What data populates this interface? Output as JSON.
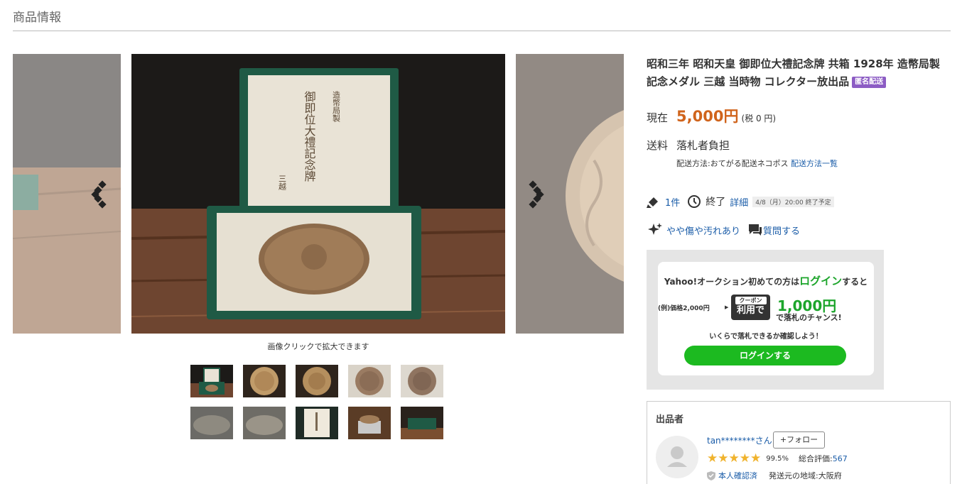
{
  "section": {
    "title": "商品情報"
  },
  "gallery": {
    "caption": "画像クリックで拡大できます",
    "medal_texts": {
      "col1": "造幣局製",
      "col2": "御即位大禮記念牌",
      "col3": "三越"
    }
  },
  "item": {
    "title": "昭和三年 昭和天皇 御即位大禮記念牌 共箱 1928年 造幣局製 記念メダル 三越 当時物 コレクター放出品",
    "badge": "匿名配送",
    "price_label": "現在",
    "price": "5,000円",
    "tax": "(税 0 円)",
    "shipping_label": "送料",
    "shipping_value": "落札者負担",
    "shipping_method": "配送方法:おてがる配送ネコポス",
    "shipping_list_link": "配送方法一覧",
    "bids": "1件",
    "end_label": "終了",
    "end_detail_link": "詳細",
    "end_note": "4/8（月）20:00 終了予定",
    "condition": "やや傷や汚れあり",
    "question": "質問する"
  },
  "coupon": {
    "line1_pre": "Yahoo!オークション初めての方は",
    "line1_login": "ログイン",
    "line1_post": "すると",
    "example": "(例)価格2,000円",
    "tag_top": "クーポン",
    "tag_bottom": "利用で",
    "amount": "1,000円",
    "chance": "で落札のチャンス!",
    "check": "いくらで落札できるか確認しよう！",
    "button": "ログインする"
  },
  "seller": {
    "header": "出品者",
    "name": "tan********さん",
    "follow": "+フォロー",
    "stars": "★★★★★",
    "percent": "99.5%",
    "rating_label": "総合評価:",
    "rating_value": "567",
    "verified": "本人確認済",
    "region": "発送元の地域:大阪府"
  },
  "colors": {
    "accent_price": "#d0641c",
    "coupon_green": "#1cba20",
    "link": "#1a5ca8"
  }
}
